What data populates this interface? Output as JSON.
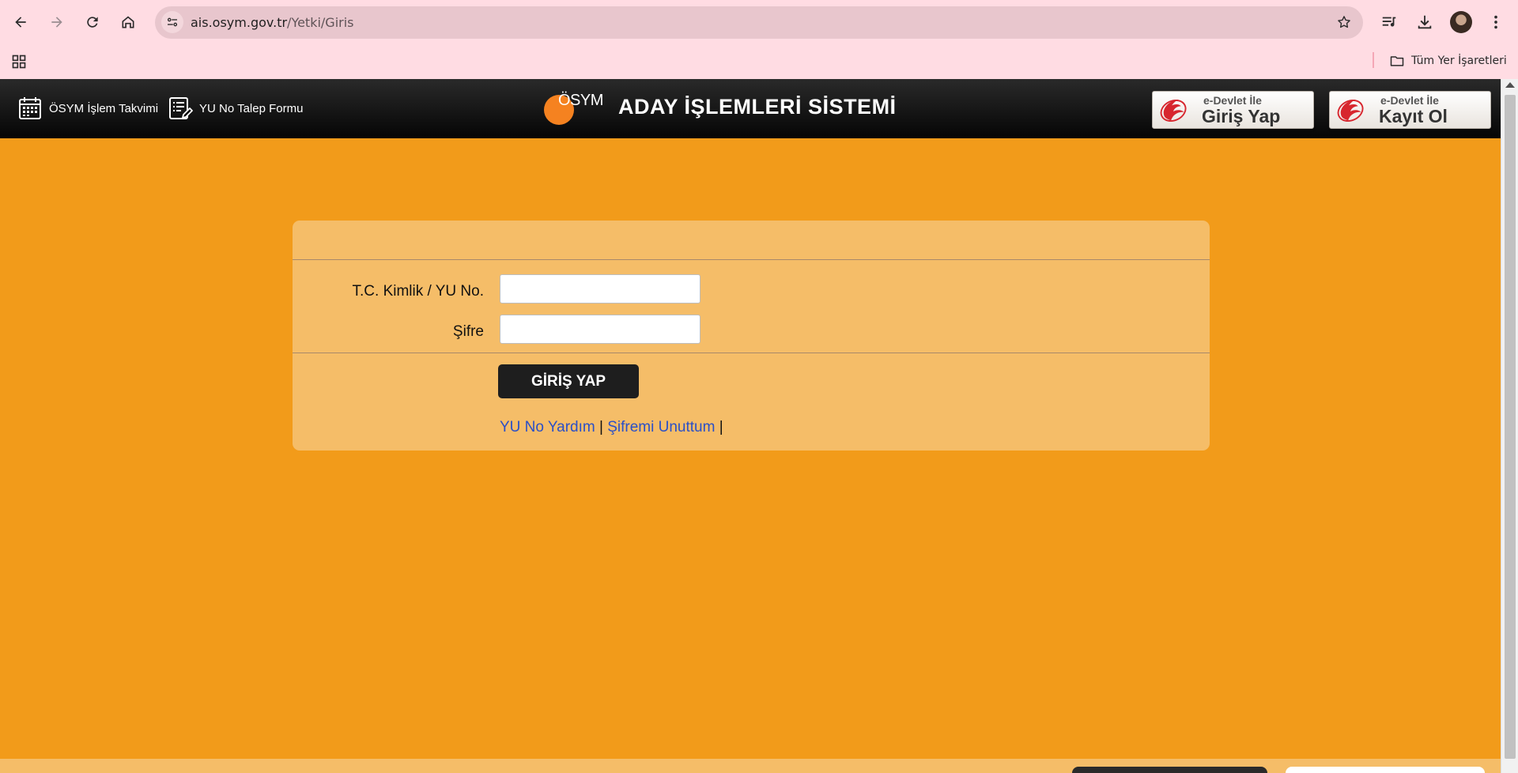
{
  "browser": {
    "url_host": "ais.osym.gov.tr",
    "url_path": "/Yetki/Giris",
    "bookmarks_all_label": "Tüm Yer İşaretleri"
  },
  "header": {
    "calendar_link": "ÖSYM İşlem Takvimi",
    "yu_form_link": "YU No Talep Formu",
    "logo_text": "ÖSYM",
    "site_title": "ADAY İŞLEMLERİ SİSTEMİ",
    "edevlet_login": {
      "small": "e-Devlet İle",
      "big": "Giriş Yap"
    },
    "edevlet_register": {
      "small": "e-Devlet İle",
      "big": "Kayıt Ol"
    }
  },
  "login": {
    "id_label": "T.C. Kimlik / YU No.",
    "id_value": "",
    "password_label": "Şifre",
    "password_value": "",
    "submit_label": "GİRİŞ YAP",
    "help_link": "YU No Yardım",
    "forgot_link": "Şifremi Unuttum",
    "separator": "|"
  },
  "colors": {
    "page_background": "#f29b1a",
    "panel_background": "#f5bd68",
    "header_background": "#0b0b0b",
    "logo_orange": "#f58220",
    "link_blue": "#2a4fc7",
    "browser_chrome": "#ffdce3"
  }
}
